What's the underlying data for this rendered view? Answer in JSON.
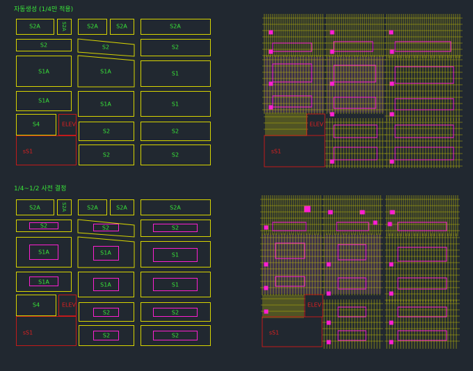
{
  "sections": {
    "auto": {
      "title": "자동생성 (1/4만 적용)"
    },
    "manual": {
      "title": "1/4~1/2 사전 결정"
    }
  },
  "labels": {
    "s2a": "S2A",
    "s2": "S2",
    "s1a": "S1A",
    "s1": "S1",
    "s4": "S4",
    "elev": "ELEV",
    "ss1": "sS1"
  },
  "colors": {
    "background": "#212830",
    "outline": "#d9d600",
    "core": "#c41a1a",
    "opening": "#ff1fd2",
    "text": "#39e639"
  }
}
